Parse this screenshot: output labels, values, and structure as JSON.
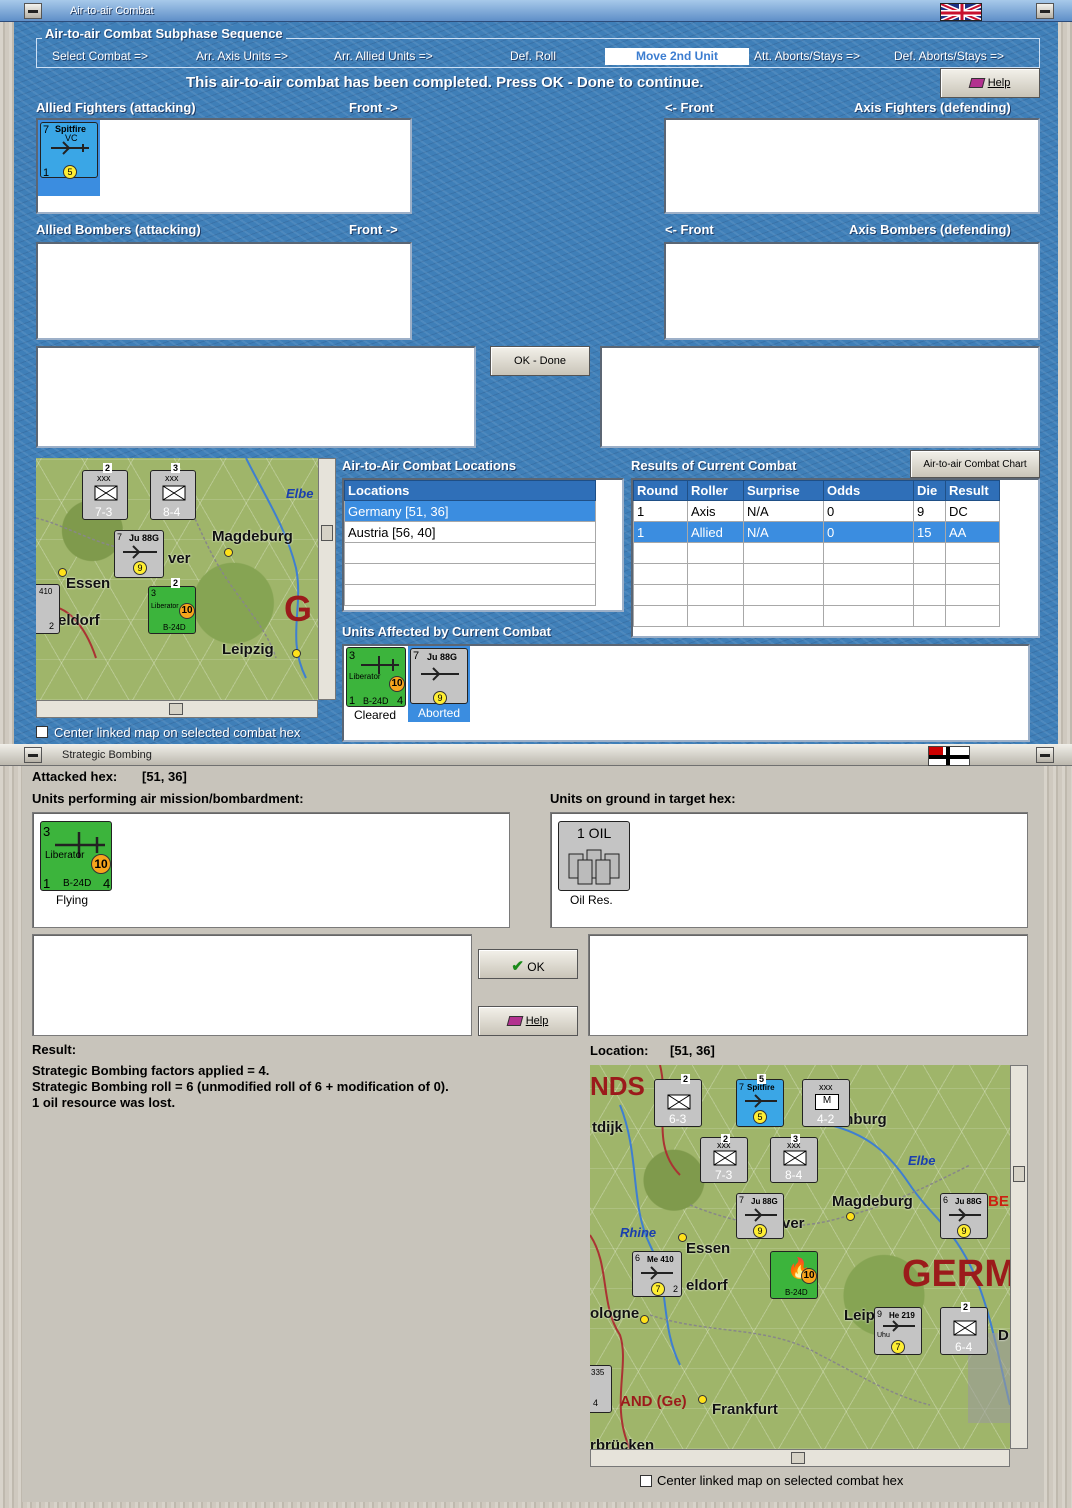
{
  "top_window": {
    "title": "Air-to-air Combat",
    "subphase_legend": "Air-to-air Combat Subphase Sequence",
    "phases": [
      "Select Combat =>",
      "Arr. Axis Units =>",
      "Arr. Allied Units =>",
      "Def. Roll",
      "Move 2nd Unit",
      "Att. Aborts/Stays =>",
      "Def. Aborts/Stays =>"
    ],
    "active_phase_index": 4,
    "status_message": "This air-to-air combat has been completed.  Press OK - Done to continue.",
    "help_label": "Help",
    "allied_fighters_label": "Allied Fighters (attacking)",
    "axis_fighters_label": "Axis Fighters (defending)",
    "allied_bombers_label": "Allied Bombers (attacking)",
    "axis_bombers_label": "Axis Bombers (defending)",
    "front_right": "Front ->",
    "front_left": "<- Front",
    "ok_done_label": "OK - Done",
    "spitfire": {
      "name": "Spitfire",
      "variant": "VC",
      "top_num": "7",
      "bottom_left": "1",
      "factor": "5"
    },
    "locations_heading": "Air-to-Air Combat Locations",
    "locations_col": "Locations",
    "locations": [
      "Germany [51, 36]",
      "Austria [56, 40]"
    ],
    "results_heading": "Results of Current Combat",
    "chart_button": "Air-to-air Combat Chart",
    "results_cols": [
      "Round",
      "Roller",
      "Surprise",
      "Odds",
      "Die",
      "Result"
    ],
    "results_rows": [
      [
        "1",
        "Axis",
        "N/A",
        "0",
        "9",
        "DC"
      ],
      [
        "1",
        "Allied",
        "N/A",
        "0",
        "15",
        "AA"
      ]
    ],
    "units_affected_heading": "Units Affected by Current Combat",
    "affected_units": [
      {
        "label": "Cleared",
        "name": "Liberator",
        "type": "B-24D",
        "top": "3",
        "bl": "1",
        "br": "4",
        "factor": "10"
      },
      {
        "label": "Aborted",
        "name": "Ju 88G",
        "top": "7",
        "factor": "9"
      }
    ],
    "center_map_checkbox": "Center linked map on selected combat hex",
    "map": {
      "cities": [
        "Magdeburg",
        "Essen",
        "eldorf",
        "Leipzig",
        "ver"
      ],
      "river": "Elbe",
      "big_letter": "G",
      "stacks": [
        {
          "top": "2",
          "label": "7-3",
          "hq": "xxx"
        },
        {
          "top": "3",
          "label": "8-4",
          "hq": "xxx"
        }
      ],
      "ju88": {
        "name": "Ju 88G",
        "top": "7",
        "factor": "9"
      },
      "lib": {
        "name": "Liberator",
        "type": "B-24D",
        "top": "3",
        "bl": "1",
        "br": "4",
        "factor": "10",
        "stack": "2"
      },
      "me410": {
        "name": "410",
        "top": "2"
      }
    }
  },
  "bottom_window": {
    "title": "Strategic Bombing",
    "attacked_hex_label": "Attacked hex:",
    "attacked_hex": "[51, 36]",
    "performing_label": "Units performing air mission/bombardment:",
    "ground_label": "Units on ground in target hex:",
    "bomber": {
      "name": "Liberator",
      "type": "B-24D",
      "top": "3",
      "bl": "1",
      "br": "4",
      "factor": "10",
      "status": "Flying"
    },
    "oil": {
      "title": "1 OIL",
      "status": "Oil Res."
    },
    "ok_label": "OK",
    "help_label": "Help",
    "result_label": "Result:",
    "result_lines": [
      "Strategic Bombing factors applied = 4.",
      "Strategic Bombing roll = 6 (unmodified roll of 6 + modification of 0).",
      "1 oil resource was lost."
    ],
    "location_label": "Location:",
    "location_value": "[51, 36]",
    "center_map_checkbox": "Center linked map on selected combat hex",
    "map": {
      "cities": [
        "NDS",
        "tdijk",
        "Magdeburg",
        "mburg",
        "Essen",
        "eldorf",
        "ologne",
        "Frankfurt",
        "rbrücken",
        "ver",
        "Leip",
        "Rhine",
        "Elbe",
        "BE",
        "AND (Ge)",
        "GERM",
        "n",
        "D"
      ],
      "counters": [
        {
          "label": "6-3",
          "top": "2",
          "hq": "xxx"
        },
        {
          "label": "7-3",
          "top": "2",
          "hq": "xxx"
        },
        {
          "label": "8-4",
          "top": "3",
          "hq": "xxx"
        },
        {
          "label": "4-2",
          "top": "3",
          "hq": "xxx",
          "mark": "M"
        },
        {
          "label": "6-4",
          "top": "2",
          "hq": "xxx"
        }
      ],
      "air_units": [
        {
          "name": "Spitfire",
          "top": "7",
          "factor": "5",
          "stack": "5"
        },
        {
          "name": "Ju 88G",
          "top": "7",
          "factor": "9"
        },
        {
          "name": "Ju 88G",
          "top": "6",
          "factor": "9"
        },
        {
          "name": "Me 410",
          "top": "6",
          "factor": "7",
          "br": "2"
        },
        {
          "name": "He 219",
          "top": "9",
          "factor": "7",
          "sub": "Uhu"
        },
        {
          "name": "335",
          "top": "4"
        }
      ]
    }
  },
  "colors": {
    "sea_blue": "#3f7fb8",
    "selected_row": "#3b8de0",
    "allied_green": "#3cb43c",
    "axis_grey": "#c4c4c4"
  }
}
